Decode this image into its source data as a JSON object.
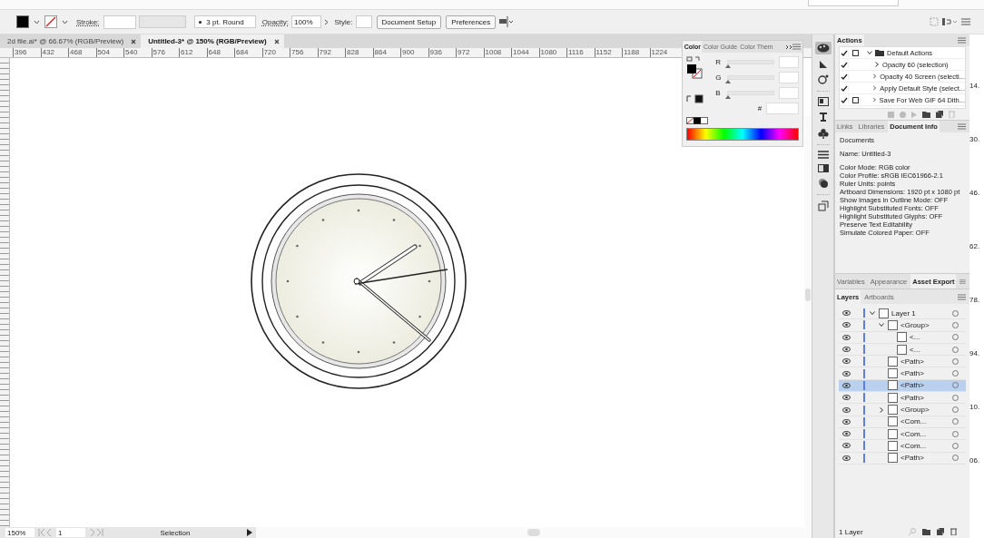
{
  "control_bar": {
    "stroke_label": "Stroke:",
    "brush": "3 pt. Round",
    "opacity_label": "Opacity:",
    "opacity": "100%",
    "style_label": "Style:",
    "buttons": [
      "Document Setup",
      "Preferences"
    ]
  },
  "tabs": [
    {
      "label": "2d file.ai* @ 66.67% (RGB/Preview)",
      "selected": false
    },
    {
      "label": "Untitled-3* @ 150% (RGB/Preview)",
      "selected": true
    }
  ],
  "ruler": [
    "396",
    "432",
    "468",
    "504",
    "540",
    "576",
    "612",
    "648",
    "684",
    "720",
    "756",
    "792",
    "828",
    "864",
    "900",
    "936",
    "972",
    "1008",
    "1044",
    "1080",
    "1116",
    "1152",
    "1188",
    "1224"
  ],
  "color_panel": {
    "tabs": [
      {
        "label": "Color",
        "selected": true
      },
      {
        "label": "Color Guide",
        "selected": false
      },
      {
        "label": "Color Them",
        "selected": false
      }
    ],
    "channels": [
      {
        "name": "R",
        "level": 0
      },
      {
        "name": "G",
        "level": 0
      },
      {
        "name": "B",
        "level": 0
      }
    ],
    "hex_label": "#"
  },
  "actions": {
    "title": "Actions",
    "rows": [
      {
        "kind": "set",
        "checked": true,
        "dialog": true,
        "expanded": true,
        "label": "Default Actions"
      },
      {
        "kind": "action",
        "checked": true,
        "dialog": false,
        "expanded": false,
        "label": "Opacity 60 (selection)"
      },
      {
        "kind": "action",
        "checked": true,
        "dialog": false,
        "expanded": false,
        "label": "Opacity 40 Screen (selecti..."
      },
      {
        "kind": "action",
        "checked": true,
        "dialog": false,
        "expanded": false,
        "label": "Apply Default Style (select..."
      },
      {
        "kind": "action",
        "checked": true,
        "dialog": true,
        "expanded": false,
        "label": "Save For Web GIF 64 Dith..."
      }
    ]
  },
  "doc_info": {
    "tabs": [
      {
        "label": "Links",
        "selected": false
      },
      {
        "label": "Libraries",
        "selected": false
      },
      {
        "label": "Document Info",
        "selected": true
      }
    ],
    "paragraphs": [
      [
        "Documents"
      ],
      [
        "Name: Untitled-3"
      ],
      [
        "Color Mode: RGB color",
        "Color Profile: sRGB IEC61966-2.1",
        "Ruler Units: points",
        "Artboard Dimensions: 1920 pt x 1080 pt",
        "Show Images in Outline Mode: OFF",
        "Highlight Substituted Fonts: OFF",
        "Highlight Substituted Glyphs: OFF",
        "Preserve Text Editability",
        "Simulate Colored Paper: OFF"
      ]
    ]
  },
  "panel_tabs": [
    {
      "label": "Variables",
      "selected": false
    },
    {
      "label": "Appearance",
      "selected": false
    },
    {
      "label": "Asset Export",
      "selected": true
    }
  ],
  "layers": {
    "tabs": [
      {
        "label": "Layers",
        "selected": true
      },
      {
        "label": "Artboards",
        "selected": false
      }
    ],
    "items": [
      {
        "name": "Layer 1",
        "selected": false,
        "expanded": true,
        "children": [
          {
            "name": "<Group>",
            "selected": false,
            "expanded": true,
            "children": [
              {
                "name": "<...",
                "selected": false
              },
              {
                "name": "<...",
                "selected": false
              }
            ]
          },
          {
            "name": "<Path>",
            "selected": false
          },
          {
            "name": "<Path>",
            "selected": false
          },
          {
            "name": "<Path>",
            "selected": true
          },
          {
            "name": "<Path>",
            "selected": false
          },
          {
            "name": "<Group>",
            "selected": false,
            "expanded": false
          },
          {
            "name": "<Com...",
            "selected": false
          },
          {
            "name": "<Com...",
            "selected": false
          },
          {
            "name": "<Com...",
            "selected": false
          },
          {
            "name": "<Path>",
            "selected": false
          }
        ]
      }
    ],
    "footer": "1 Layer"
  },
  "status_bar": {
    "zoom": "150%",
    "artboard": "1",
    "tool": "Selection"
  },
  "edge_labels": [
    "14.",
    "30.",
    "46.",
    "62.",
    "78.",
    "94.",
    "10.",
    "06."
  ]
}
